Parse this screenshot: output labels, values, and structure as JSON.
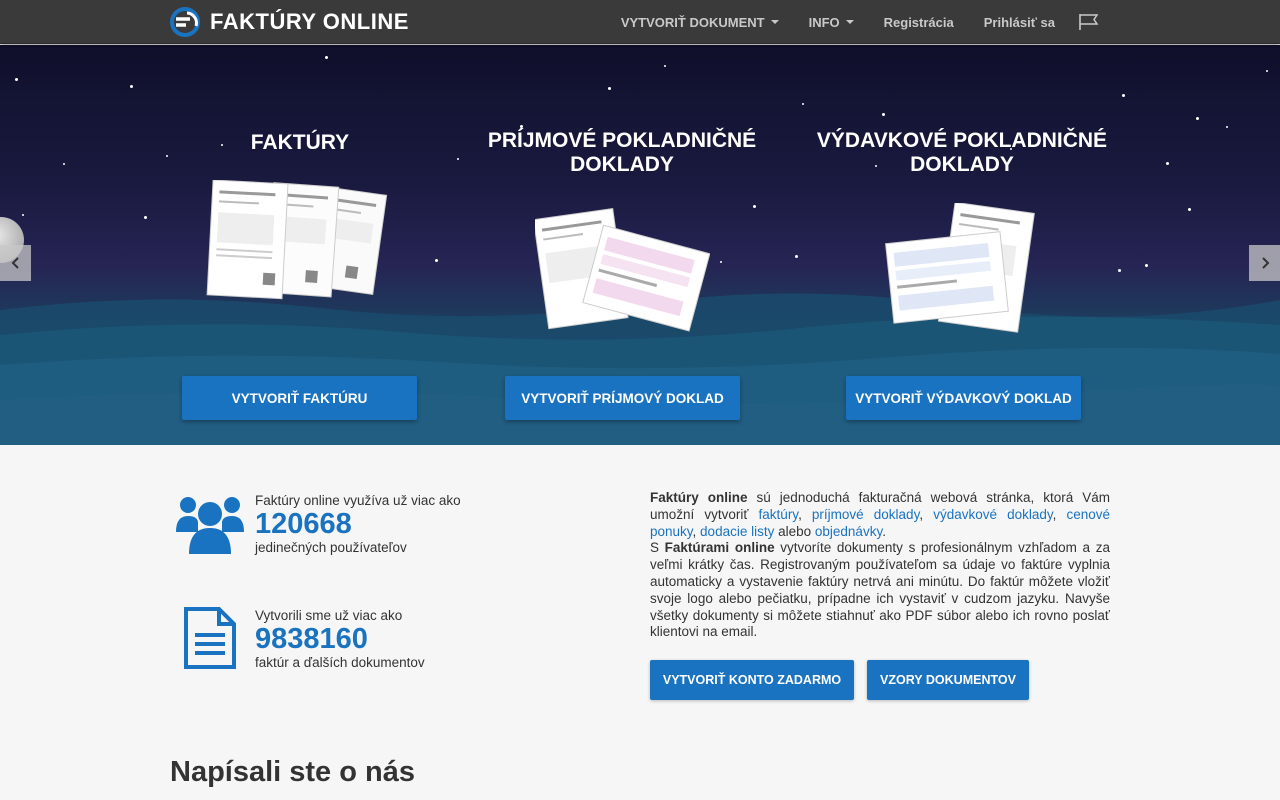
{
  "navbar": {
    "brand": "FAKTÚRY ONLINE",
    "items": [
      {
        "label": "VYTVORIŤ DOKUMENT",
        "dropdown": true
      },
      {
        "label": "INFO",
        "dropdown": true
      },
      {
        "label": "Registrácia",
        "dropdown": false
      },
      {
        "label": "Prihlásiť sa",
        "dropdown": false
      }
    ],
    "flag_icon": "flag-icon"
  },
  "hero": {
    "columns": [
      {
        "title": "FAKTÚRY",
        "button": "VYTVORIŤ FAKTÚRU"
      },
      {
        "title_line1": "PRÍJMOVÉ POKLADNIČNÉ",
        "title_line2": "DOKLADY",
        "button": "VYTVORIŤ PRÍJMOVÝ DOKLAD"
      },
      {
        "title_line1": "VÝDAVKOVÉ POKLADNIČNÉ",
        "title_line2": "DOKLADY",
        "button": "VYTVORIŤ VÝDAVKOVÝ DOKLAD"
      }
    ]
  },
  "stats": {
    "users": {
      "prefix": "Faktúry online využíva už viac ako",
      "number": "120668",
      "suffix": "jedinečných používateľov"
    },
    "documents": {
      "prefix": "Vytvorili sme už viac ako",
      "number": "9838160",
      "suffix": "faktúr a ďalších dokumentov"
    }
  },
  "about": {
    "p1_bold": "Faktúry online",
    "p1_text": " sú jednoduchá fakturačná webová stránka, ktorá Vám umožní vytvoriť ",
    "links": [
      "faktúry",
      "príjmové doklady",
      "výdavkové doklady",
      "cenové ponuky",
      "dodacie listy",
      "objednávky"
    ],
    "sep1": ", ",
    "sep_or": " alebo ",
    "end": ".",
    "p2_start": "S ",
    "p2_bold": "Faktúrami online",
    "p2_text": " vytvoríte dokumenty s profesionálnym vzhľadom a za veľmi krátky čas. Registrovaným používateľom sa údaje vo faktúre vyplnia automaticky a vystavenie faktúry netrvá ani minútu. Do faktúr môžete vložiť svoje logo alebo pečiatku, prípadne ich vystaviť v cudzom jazyku. Navyše všetky dokumenty si môžete stiahnuť ako PDF súbor alebo ich rovno poslať klientovi na email.",
    "buttons": {
      "create_account": "VYTVORIŤ KONTO ZADARMO",
      "samples": "VZORY DOKUMENTOV"
    }
  },
  "section": {
    "title": "Napísali ste o nás"
  },
  "colors": {
    "navbar": "#3a3a3a",
    "accent": "#1a73c0",
    "page_bg": "#f6f6f6"
  }
}
